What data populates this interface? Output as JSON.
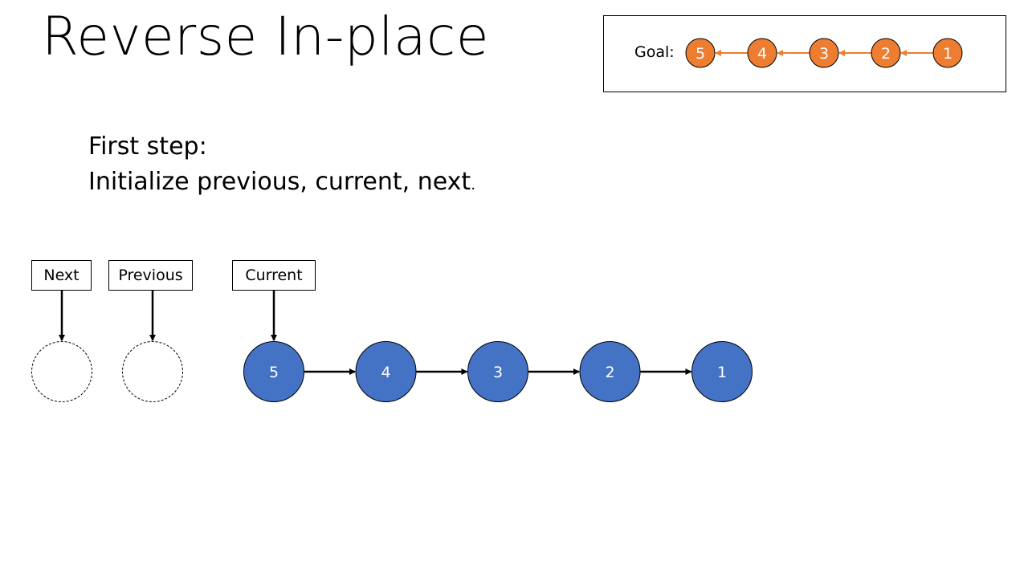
{
  "slide": {
    "title": "Reverse In-place",
    "steps": [
      "First step:",
      "Initialize previous, current, next"
    ],
    "step2_trailing_dot": "."
  },
  "goal": {
    "label": "Goal:",
    "nodes": [
      "5",
      "4",
      "3",
      "2",
      "1"
    ],
    "node_color": "#ED7D31",
    "arrow_color": "#ED7D31"
  },
  "pointers": {
    "next": "Next",
    "previous": "Previous",
    "current": "Current"
  },
  "list": {
    "nodes": [
      "5",
      "4",
      "3",
      "2",
      "1"
    ],
    "node_color": "#4472C4"
  }
}
